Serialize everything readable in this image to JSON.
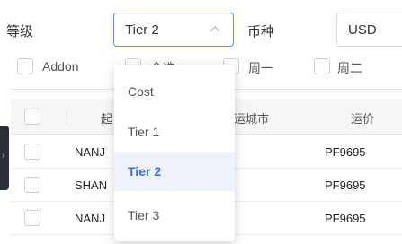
{
  "filters": {
    "level_label": "等级",
    "level_value": "Tier 2",
    "currency_label": "币种",
    "currency_value": "USD"
  },
  "checkboxes": [
    {
      "label": "Addon"
    },
    {
      "label": "全选"
    },
    {
      "label": "周一"
    },
    {
      "label": "周二"
    }
  ],
  "table": {
    "headers": [
      "起",
      "运城市",
      "运价"
    ],
    "rows": [
      {
        "origin": "NANJ",
        "price": "PF9695"
      },
      {
        "origin": "SHAN",
        "price": "PF9695"
      },
      {
        "origin": "NANJ",
        "price": "PF9695"
      }
    ]
  },
  "dropdown": {
    "options": [
      "Cost",
      "Tier 1",
      "Tier 2",
      "Tier 3"
    ],
    "selected": "Tier 2"
  },
  "colors": {
    "accent": "#3a6fd8",
    "active_bg": "#eef2fb",
    "header_bg": "#f5f6f8"
  }
}
